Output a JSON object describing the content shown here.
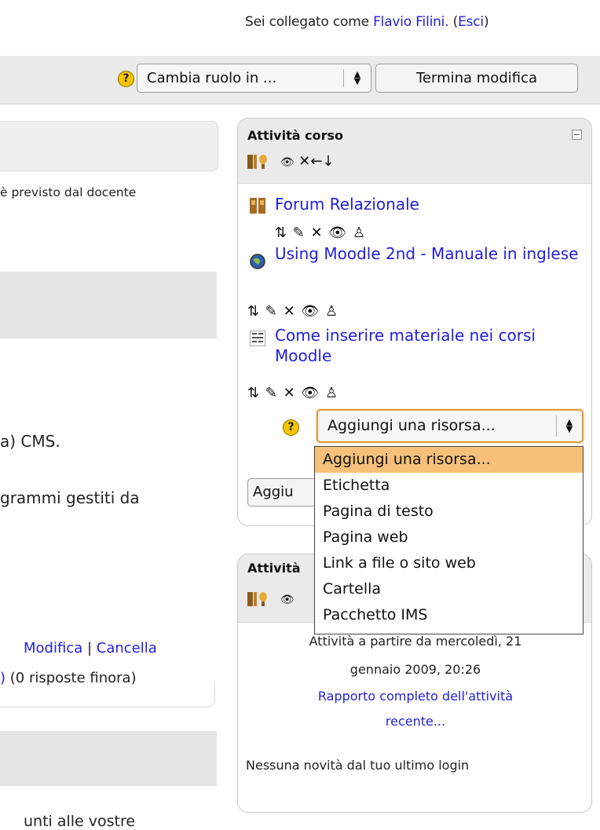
{
  "header": {
    "login_prefix": "Sei collegato come ",
    "user_name": "Flavio Filini.",
    "logout_open": " (",
    "logout_label": "Esci",
    "logout_close": ")"
  },
  "navbar": {
    "help_glyph": "?",
    "role_select_value": "Cambia ruolo in ...",
    "finish_editing_label": "Termina modifica"
  },
  "left": {
    "line1": "è previsto dal docente",
    "line2": "a) CMS.",
    "line3": "grammi gestiti da",
    "modifica": "Modifica",
    "separator": " | ",
    "cancella": "Cancella",
    "responses_link": ")",
    "responses_text": " (0 risposte finora)",
    "bottom_cut": "unti alle vostre"
  },
  "course_activities_block": {
    "title": "Attività  corso",
    "header_icons": "✕←↓",
    "resources": [
      {
        "label": "Forum Relazionale",
        "icon": "forum-icon"
      },
      {
        "label": "Using Moodle 2nd - Manuale in inglese",
        "icon": "web-globe-icon"
      },
      {
        "label": "Come inserire materiale nei corsi Moodle",
        "icon": "page-icon"
      }
    ],
    "edit_icons": "⇅ ✎ ✕ 👁 ♙",
    "add_resource_select": "Aggiungi una risorsa...",
    "add_activity_button": "Aggiu"
  },
  "recent_block": {
    "title": "Attività",
    "header_icons": "👁",
    "text_line1": "Attività a partire da mercoledì, 21",
    "text_line2": "gennaio 2009, 20:26",
    "report_line1": "Rapporto completo dell'attività",
    "report_line2": "recente...",
    "no_news": "Nessuna novità dal tuo ultimo login"
  },
  "add_resource_dropdown": {
    "options": [
      "Aggiungi una risorsa...",
      "Etichetta",
      "Pagina di testo",
      "Pagina web",
      "Link a file o sito web",
      "Cartella",
      "Pacchetto IMS"
    ],
    "selected_index": 0
  },
  "colors": {
    "link": "#1f1fd8",
    "highlight": "#f6c07a",
    "help_icon": "#f4c500"
  }
}
